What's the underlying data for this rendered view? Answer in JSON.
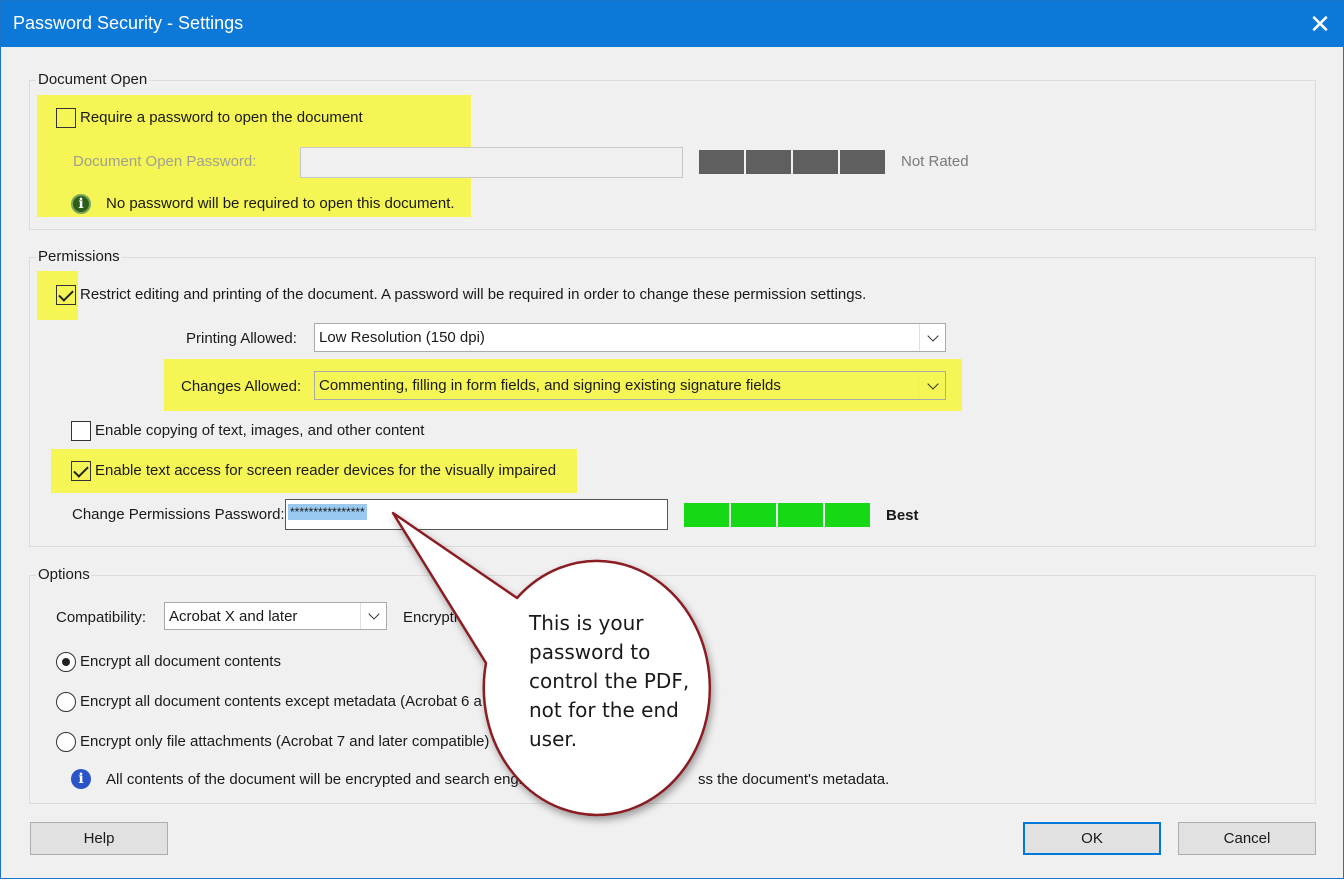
{
  "window": {
    "title": "Password Security - Settings",
    "close_glyph": "✕"
  },
  "document_open": {
    "group_label": "Document Open",
    "require_checkbox_label": "Require a password to open the document",
    "require_checked": false,
    "password_label": "Document Open Password:",
    "password_value": "",
    "strength_label": "Not Rated",
    "strength_color": "#5f5f5f",
    "info_text": "No password will be required to open this document."
  },
  "permissions": {
    "group_label": "Permissions",
    "restrict_label": "Restrict editing and printing of the document. A password will be required in order to change these permission settings.",
    "restrict_checked": true,
    "printing_label": "Printing Allowed:",
    "printing_value": "Low Resolution (150 dpi)",
    "changes_label": "Changes Allowed:",
    "changes_value": "Commenting, filling in form fields, and signing existing signature fields",
    "copy_label": "Enable copying of text, images, and other content",
    "copy_checked": false,
    "screen_reader_label": "Enable text access for screen reader devices for the visually impaired",
    "screen_reader_checked": true,
    "password_label": "Change Permissions Password:",
    "password_value": "****************",
    "strength_label": "Best",
    "strength_color": "#17d817"
  },
  "options": {
    "group_label": "Options",
    "compat_label": "Compatibility:",
    "compat_value": "Acrobat X and later",
    "encryption_label": "Encrypti",
    "radio_all": "Encrypt all document contents",
    "radio_except_metadata": "Encrypt all document contents except metadata (Acrobat 6 a",
    "radio_attachments": "Encrypt only file attachments (Acrobat 7 and later compatible)",
    "selected_radio": "radio_all",
    "info_text_left": "All contents of the document will be encrypted and search engi",
    "info_text_right": "ss the document's metadata."
  },
  "buttons": {
    "help": "Help",
    "ok": "OK",
    "cancel": "Cancel"
  },
  "callout": {
    "lines": [
      "This is your",
      "password to",
      "control the PDF,",
      "not for the end",
      "user."
    ]
  },
  "colors": {
    "highlight": "#f5f556",
    "title_bar": "#0c78d7",
    "callout_border": "#8a1c22"
  }
}
